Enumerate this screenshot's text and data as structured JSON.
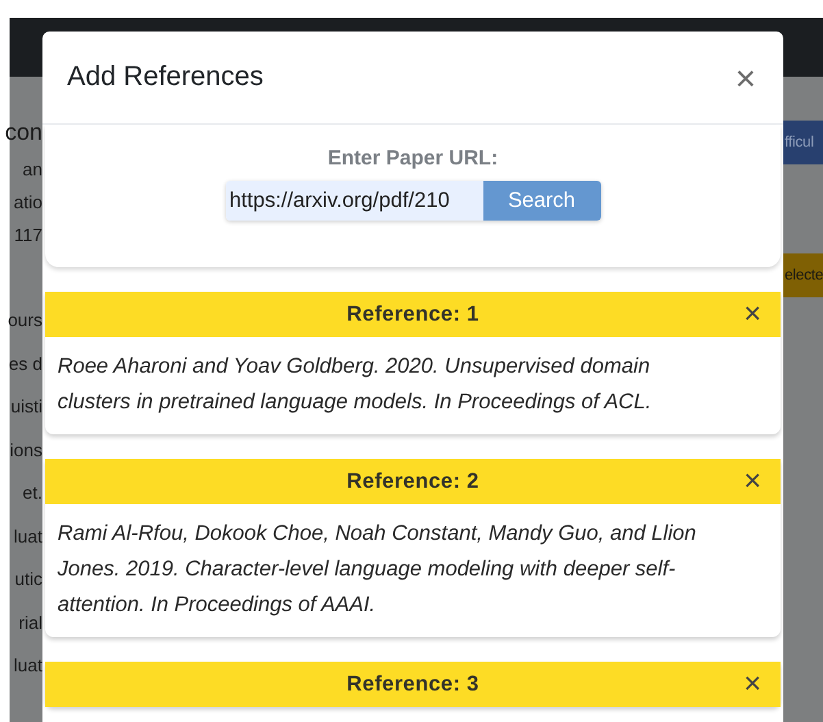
{
  "background_page": {
    "left_fragments": [
      {
        "text": "con",
        "kind": "heading"
      },
      {
        "text": "an",
        "kind": "line"
      },
      {
        "text": "atio",
        "kind": "line"
      },
      {
        "text": "117",
        "kind": "line"
      },
      {
        "text": "ours",
        "kind": "row"
      },
      {
        "text": "es d",
        "kind": "row"
      },
      {
        "text": "uisti",
        "kind": "row"
      },
      {
        "text": "ions",
        "kind": "row"
      },
      {
        "text": "et.",
        "kind": "row"
      },
      {
        "text": "luat",
        "kind": "row"
      },
      {
        "text": "utic",
        "kind": "row"
      },
      {
        "text": "rial",
        "kind": "row"
      },
      {
        "text": "luat",
        "kind": "row"
      }
    ],
    "right_buttons": [
      {
        "label": "fficul",
        "kind": "primary"
      },
      {
        "label": "electe",
        "kind": "warning"
      }
    ]
  },
  "modal": {
    "title": "Add References",
    "close": "×",
    "url_search": {
      "label": "Enter Paper URL:",
      "value": "https://arxiv.org/pdf/210",
      "button": "Search"
    },
    "references": [
      {
        "title": "Reference: 1",
        "remove": "×",
        "text": "Roee Aharoni and Yoav Goldberg. 2020. Unsupervised domain clusters in pretrained language models. In Proceedings of ACL."
      },
      {
        "title": "Reference: 2",
        "remove": "×",
        "text": "Rami Al-Rfou, Dokook Choe, Noah Constant, Mandy Guo, and Llion Jones. 2019. Character-level language modeling with deeper self-attention. In Proceedings of AAAI."
      },
      {
        "title": "Reference: 3",
        "remove": "×"
      }
    ]
  }
}
